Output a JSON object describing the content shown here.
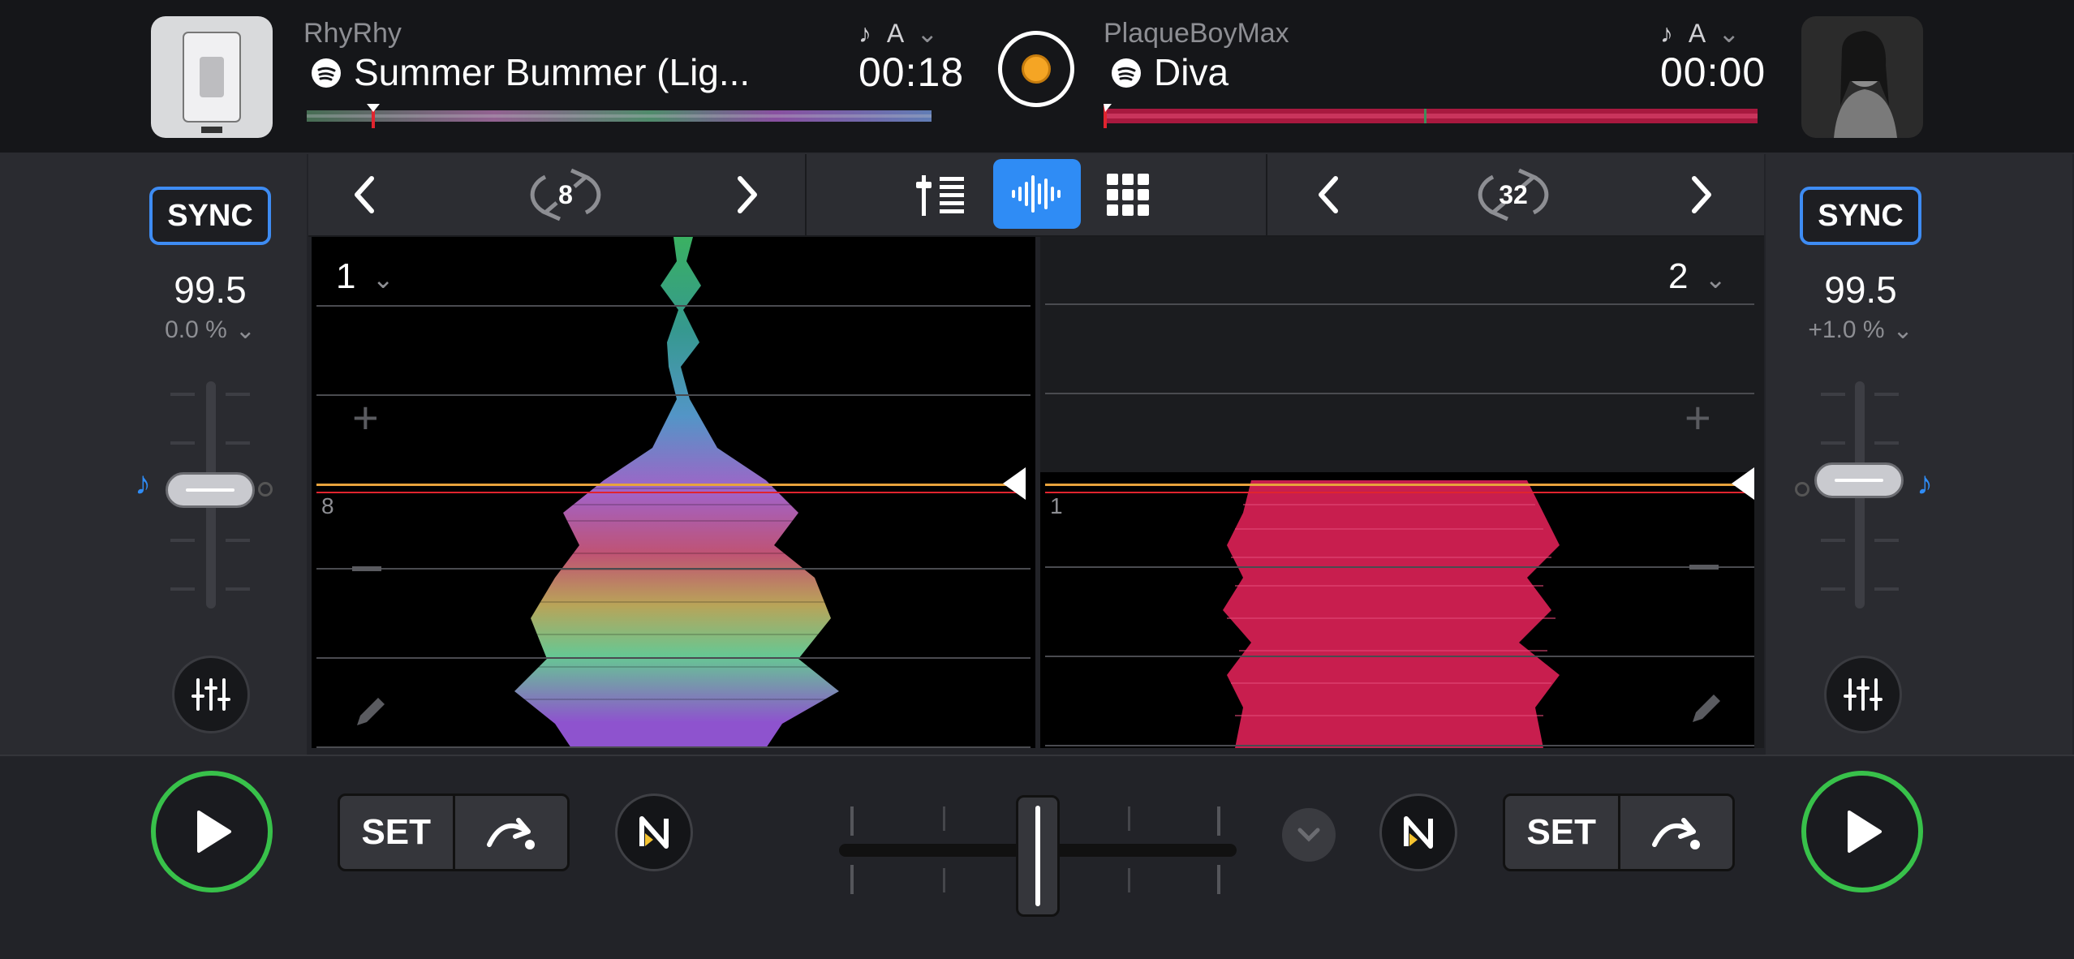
{
  "deck1": {
    "artist": "RhyRhy",
    "title": "Summer Bummer (Lig...",
    "time": "00:18",
    "key": "A",
    "bpm": "99.5",
    "pitch": "0.0 %",
    "deck_number": "1",
    "beat_label": "8",
    "loop_size": "8",
    "sync_label": "SYNC",
    "set_label": "SET",
    "progress": 0.1
  },
  "deck2": {
    "artist": "PlaqueBoyMax",
    "title": "Diva",
    "time": "00:00",
    "key": "A",
    "bpm": "99.5",
    "pitch": "+1.0 %",
    "deck_number": "2",
    "beat_label": "1",
    "loop_size": "32",
    "sync_label": "SYNC",
    "set_label": "SET",
    "progress": 0.0
  },
  "center": {
    "view_mode": "waveform",
    "crossfader": 0.5
  },
  "colors": {
    "accent_blue": "#2f8cf5",
    "play_green": "#38c14a",
    "record_orange": "#f5a524",
    "deck2_wave": "#d8245a"
  },
  "icons": [
    "spotify-icon",
    "music-note-icon",
    "chevron-down-icon",
    "record-icon",
    "chevron-left-icon",
    "chevron-right-icon",
    "loop-icon",
    "mixer-icon",
    "waveform-icon",
    "grid-icon",
    "plus-icon",
    "minus-icon",
    "pencil-icon",
    "eq-icon",
    "play-icon",
    "cue-arrow-icon",
    "neural-mix-icon"
  ]
}
